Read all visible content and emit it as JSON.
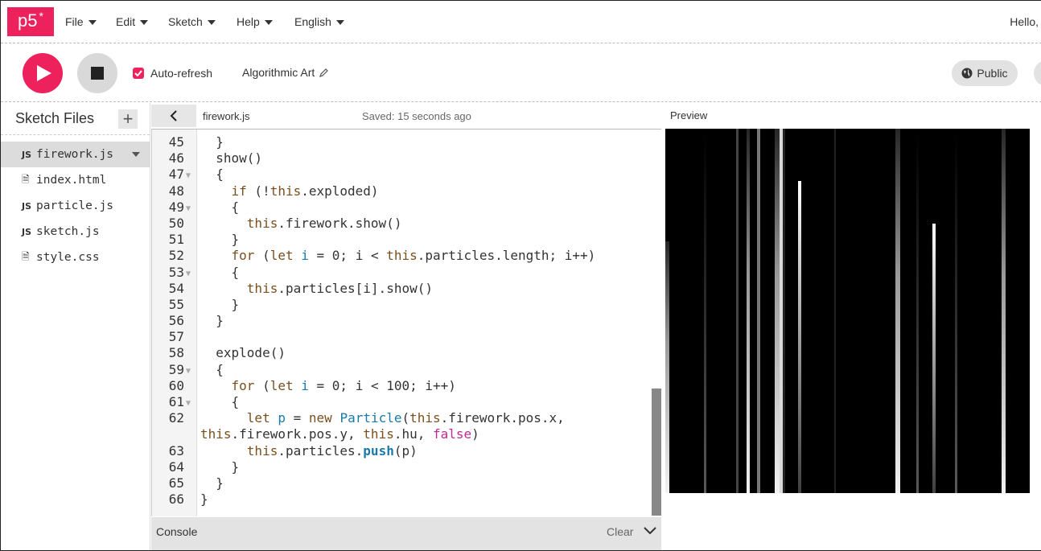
{
  "nav": {
    "logo": "p5",
    "logo_star": "*",
    "menus": [
      {
        "label": "File"
      },
      {
        "label": "Edit"
      },
      {
        "label": "Sketch"
      },
      {
        "label": "Help"
      },
      {
        "label": "English"
      }
    ],
    "greeting": "Hello,"
  },
  "toolbar": {
    "auto_refresh_label": "Auto-refresh",
    "auto_refresh_checked": true,
    "sketch_name": "Algorithmic Art",
    "visibility_label": "Public"
  },
  "sidebar": {
    "title": "Sketch Files",
    "files": [
      {
        "icon": "JS",
        "name": "firework.js",
        "active": true
      },
      {
        "icon": "doc",
        "name": "index.html",
        "active": false
      },
      {
        "icon": "JS",
        "name": "particle.js",
        "active": false
      },
      {
        "icon": "JS",
        "name": "sketch.js",
        "active": false
      },
      {
        "icon": "doc",
        "name": "style.css",
        "active": false
      }
    ]
  },
  "editor": {
    "file_name": "firework.js",
    "saved_status": "Saved: 15 seconds ago",
    "lines": [
      {
        "n": "45",
        "fold": false,
        "code": "  }"
      },
      {
        "n": "46",
        "fold": false,
        "code": "  show()"
      },
      {
        "n": "47",
        "fold": true,
        "code": "  {"
      },
      {
        "n": "48",
        "fold": false,
        "code": "    if (!this.exploded)"
      },
      {
        "n": "49",
        "fold": true,
        "code": "    {"
      },
      {
        "n": "50",
        "fold": false,
        "code": "      this.firework.show()"
      },
      {
        "n": "51",
        "fold": false,
        "code": "    }"
      },
      {
        "n": "52",
        "fold": false,
        "code": "    for (let i = 0; i < this.particles.length; i++)"
      },
      {
        "n": "53",
        "fold": true,
        "code": "    {"
      },
      {
        "n": "54",
        "fold": false,
        "code": "      this.particles[i].show()"
      },
      {
        "n": "55",
        "fold": false,
        "code": "    }"
      },
      {
        "n": "56",
        "fold": false,
        "code": "  }"
      },
      {
        "n": "57",
        "fold": false,
        "code": ""
      },
      {
        "n": "58",
        "fold": false,
        "code": "  explode()"
      },
      {
        "n": "59",
        "fold": true,
        "code": "  {"
      },
      {
        "n": "60",
        "fold": false,
        "code": "    for (let i = 0; i < 100; i++)"
      },
      {
        "n": "61",
        "fold": true,
        "code": "    {"
      },
      {
        "n": "62",
        "fold": false,
        "code": "      let p = new Particle(this.firework.pos.x,"
      },
      {
        "n": "",
        "fold": false,
        "code": "this.firework.pos.y, this.hu, false)"
      },
      {
        "n": "63",
        "fold": false,
        "code": "      this.particles.push(p)"
      },
      {
        "n": "64",
        "fold": false,
        "code": "    }"
      },
      {
        "n": "65",
        "fold": false,
        "code": "  }"
      },
      {
        "n": "66",
        "fold": false,
        "code": "}"
      }
    ]
  },
  "console": {
    "title": "Console",
    "clear_label": "Clear"
  },
  "preview": {
    "label": "Preview"
  },
  "colors": {
    "brand": "#ed225d",
    "keyword": "#7a4f1e",
    "variable": "#1a7aa8",
    "boolean": "#c3288f"
  }
}
